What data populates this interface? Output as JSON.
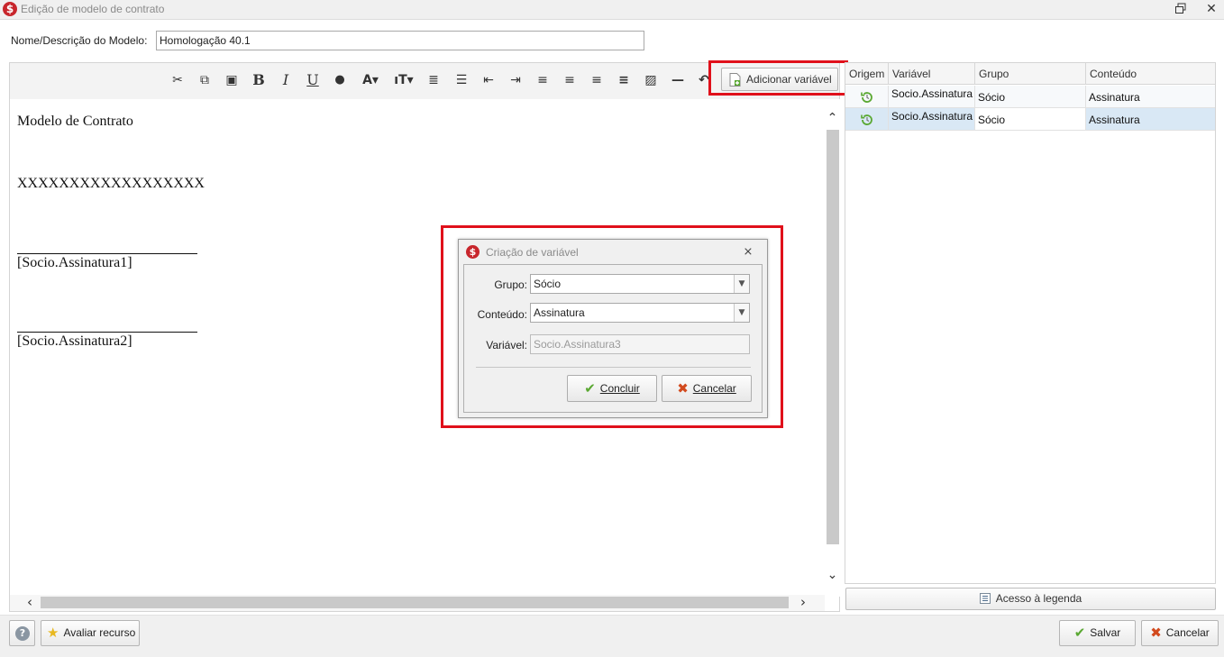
{
  "window": {
    "title": "Edição de modelo de contrato",
    "app_icon_glyph": "$"
  },
  "form": {
    "name_label": "Nome/Descrição do Modelo:",
    "name_value": "Homologação 40.1"
  },
  "toolbar": {
    "add_variable_label": "Adicionar variável",
    "buttons": [
      {
        "name": "scissors-icon",
        "glyph": "✂"
      },
      {
        "name": "copy-icon",
        "glyph": "⧉"
      },
      {
        "name": "paste-icon",
        "glyph": "▣"
      },
      {
        "name": "bold-icon",
        "glyph": "B"
      },
      {
        "name": "italic-icon",
        "glyph": "I"
      },
      {
        "name": "underline-icon",
        "glyph": "U"
      },
      {
        "name": "color-drop-icon",
        "glyph": "●"
      },
      {
        "name": "font-color-icon",
        "glyph": "A▾"
      },
      {
        "name": "font-size-icon",
        "glyph": "ıT▾"
      },
      {
        "name": "ordered-list-icon",
        "glyph": "≣"
      },
      {
        "name": "bullet-list-icon",
        "glyph": "☰"
      },
      {
        "name": "outdent-icon",
        "glyph": "⇤"
      },
      {
        "name": "indent-icon",
        "glyph": "⇥"
      },
      {
        "name": "align-left-icon",
        "glyph": "≡"
      },
      {
        "name": "align-center-icon",
        "glyph": "≡"
      },
      {
        "name": "align-right-icon",
        "glyph": "≡"
      },
      {
        "name": "justify-icon",
        "glyph": "≡"
      },
      {
        "name": "image-icon",
        "glyph": "▨"
      },
      {
        "name": "horizontal-rule-icon",
        "glyph": "—"
      },
      {
        "name": "undo-icon",
        "glyph": "↶"
      }
    ]
  },
  "document": {
    "title": "Modelo de Contrato",
    "placeholder": "XXXXXXXXXXXXXXXXXX",
    "signature1": "[Socio.Assinatura1]",
    "signature2": "[Socio.Assinatura2]"
  },
  "dialog": {
    "title": "Criação de variável",
    "group_label": "Grupo:",
    "group_value": "Sócio",
    "content_label": "Conteúdo:",
    "content_value": "Assinatura",
    "variable_label": "Variável:",
    "variable_value": "Socio.Assinatura3",
    "confirm_label": "Concluir",
    "cancel_label": "Cancelar"
  },
  "variables_table": {
    "headers": [
      "Origem",
      "Variável",
      "Grupo",
      "Conteúdo"
    ],
    "rows": [
      {
        "variable": "Socio.Assinatura",
        "group": "Sócio",
        "content": "Assinatura"
      },
      {
        "variable": "Socio.Assinatura",
        "group": "Sócio",
        "content": "Assinatura"
      }
    ],
    "legend_button": "Acesso à legenda"
  },
  "footer": {
    "help_glyph": "?",
    "rate_label": "Avaliar recurso",
    "save_label": "Salvar",
    "cancel_label": "Cancelar"
  },
  "colors": {
    "highlight": "#e0101b",
    "brand": "#c8262c",
    "check_green": "#5aa832",
    "cancel_red": "#d24a1e",
    "selected_row": "#d9e8f5"
  }
}
